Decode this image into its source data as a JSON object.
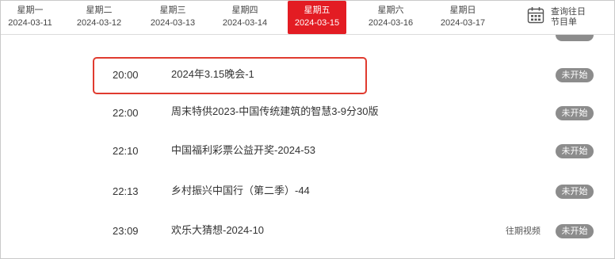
{
  "days": [
    {
      "weekday": "星期一",
      "date": "2024-03-11",
      "active": false
    },
    {
      "weekday": "星期二",
      "date": "2024-03-12",
      "active": false
    },
    {
      "weekday": "星期三",
      "date": "2024-03-13",
      "active": false
    },
    {
      "weekday": "星期四",
      "date": "2024-03-14",
      "active": false
    },
    {
      "weekday": "星期五",
      "date": "2024-03-15",
      "active": true
    },
    {
      "weekday": "星期六",
      "date": "2024-03-16",
      "active": false
    },
    {
      "weekday": "星期日",
      "date": "2024-03-17",
      "active": false
    }
  ],
  "past_schedule": {
    "line1": "查询往日",
    "line2": "节目单",
    "icon": "calendar-icon"
  },
  "programs": [
    {
      "time": "20:00",
      "title": "2024年3.15晚会-1",
      "status": "未开始",
      "replay": ""
    },
    {
      "time": "22:00",
      "title": "周末特供2023-中国传统建筑的智慧3-9分30版",
      "status": "未开始",
      "replay": ""
    },
    {
      "time": "22:10",
      "title": "中国福利彩票公益开奖-2024-53",
      "status": "未开始",
      "replay": ""
    },
    {
      "time": "22:13",
      "title": "乡村振兴中国行（第二季）-44",
      "status": "未开始",
      "replay": ""
    },
    {
      "time": "23:09",
      "title": "欢乐大猜想-2024-10",
      "status": "未开始",
      "replay": "往期视频"
    }
  ],
  "colors": {
    "accent": "#e31c23",
    "highlight_border": "#e03b2f",
    "status_bg": "#8c8c8c"
  }
}
